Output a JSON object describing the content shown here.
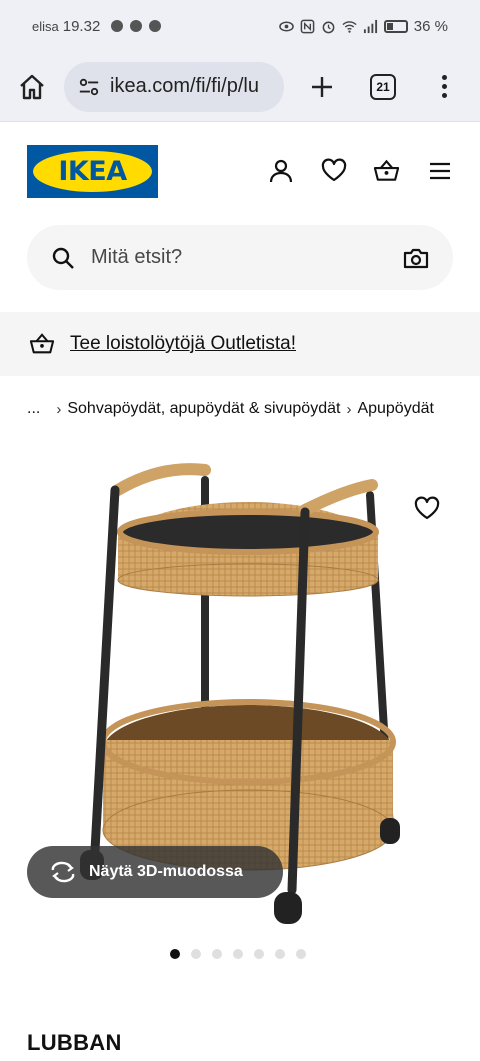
{
  "status_bar": {
    "carrier": "elisa",
    "time": "19.32",
    "battery": "36 %",
    "icons": [
      "chat-icon",
      "facebook-icon",
      "facebook-icon",
      "eye-icon",
      "nfc-icon",
      "alarm-icon",
      "wifi-icon",
      "signal-icon",
      "battery-icon"
    ]
  },
  "browser": {
    "url": "ikea.com/fi/fi/p/lu",
    "tab_count": "21"
  },
  "header": {
    "logo_text": "IKEA",
    "brand_blue": "#0058a3",
    "brand_yellow": "#ffdb00"
  },
  "search": {
    "placeholder": "Mitä etsit?"
  },
  "outlet": {
    "text": "Tee loistolöytöjä Outletista!"
  },
  "breadcrumb": {
    "ellipsis": "...",
    "items": [
      "Sohvapöydät, apupöydät & sivupöydät",
      "Apupöydät"
    ]
  },
  "gallery": {
    "view_3d_label": "Näytä 3D-muodossa",
    "dot_count": 7,
    "active_index": 0
  },
  "product": {
    "name": "LUBBAN"
  }
}
